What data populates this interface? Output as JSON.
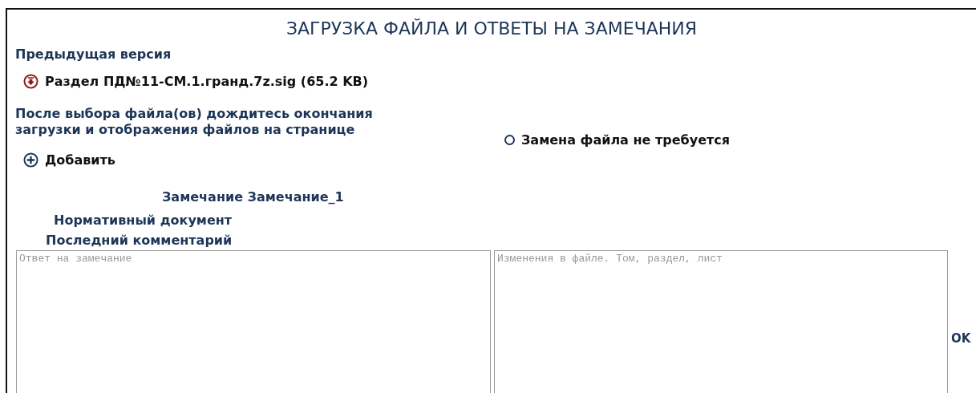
{
  "title": "ЗАГРУЗКА ФАЙЛА И ОТВЕТЫ НА ЗАМЕЧАНИЯ",
  "previous_version": {
    "label": "Предыдущая версия",
    "file": "Раздел ПД№11-СМ.1.гранд.7z.sig (65.2 KB)"
  },
  "upload_hint": "После выбора файла(ов) дождитесь окончания загрузки и отображения файлов на странице",
  "no_replacement": {
    "label": "Замена файла не требуется",
    "selected": false
  },
  "add_button": "Добавить",
  "remark": {
    "title": "Замечание Замечание_1",
    "normative_document": "Нормативный документ",
    "last_comment": "Последний комментарий"
  },
  "answer_field": {
    "placeholder": "Ответ на замечание"
  },
  "changes_field": {
    "placeholder": "Изменения в файле. Том, раздел, лист"
  },
  "ok_button": "OK"
}
